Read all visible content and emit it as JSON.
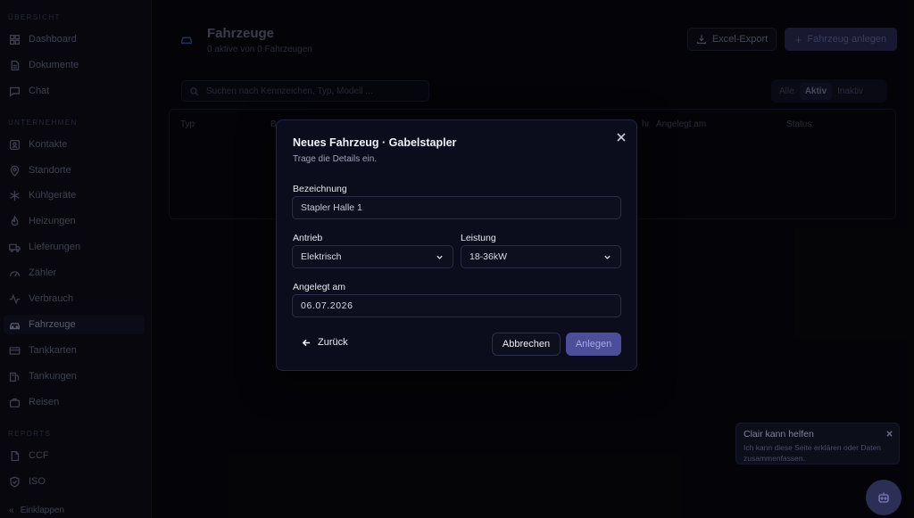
{
  "sidebar": {
    "section_overview": "ÜBERSICHT",
    "section_company": "UNTERNEHMEN",
    "section_reports": "REPORTS",
    "items_overview": [
      {
        "label": "Dashboard",
        "icon": "grid-icon"
      },
      {
        "label": "Dokumente",
        "icon": "document-icon"
      },
      {
        "label": "Chat",
        "icon": "chat-icon"
      }
    ],
    "items_company": [
      {
        "label": "Kontakte",
        "icon": "contacts-icon"
      },
      {
        "label": "Standorte",
        "icon": "location-pin-icon"
      },
      {
        "label": "Kühlgeräte",
        "icon": "snowflake-icon"
      },
      {
        "label": "Heizungen",
        "icon": "flame-icon"
      },
      {
        "label": "Lieferungen",
        "icon": "truck-icon"
      },
      {
        "label": "Zähler",
        "icon": "gauge-icon"
      },
      {
        "label": "Verbrauch",
        "icon": "activity-icon"
      },
      {
        "label": "Fahrzeuge",
        "icon": "car-icon",
        "active": true
      },
      {
        "label": "Tankkarten",
        "icon": "card-icon"
      },
      {
        "label": "Tankungen",
        "icon": "fuel-icon"
      },
      {
        "label": "Reisen",
        "icon": "trip-icon"
      }
    ],
    "items_reports": [
      {
        "label": "CCF",
        "icon": "file-icon"
      },
      {
        "label": "ISO",
        "icon": "shield-icon"
      }
    ],
    "collapse_label": "Einklappen"
  },
  "page": {
    "title": "Fahrzeuge",
    "subtitle": "0 aktive von 0 Fahrzeugen",
    "export_label": "Excel-Export",
    "add_label": "Fahrzeug anlegen",
    "search_placeholder": "Suchen nach Kennzeichen, Typ, Modell ...",
    "filters": [
      "Alle",
      "Aktiv",
      "Inaktiv"
    ],
    "active_filter": "Aktiv",
    "columns": [
      "Typ",
      "B",
      "hr",
      "Angelegt am",
      "Status"
    ]
  },
  "modal": {
    "title": "Neues Fahrzeug · Gabelstapler",
    "subtitle": "Trage die Details ein.",
    "name_label": "Bezeichnung",
    "name_value": "Stapler Halle 1",
    "drive_label": "Antrieb",
    "drive_value": "Elektrisch",
    "power_label": "Leistung",
    "power_value": "18-36kW",
    "date_label": "Angelegt am",
    "date_value": "06.07.2026",
    "back_label": "Zurück",
    "cancel_label": "Abbrechen",
    "create_label": "Anlegen"
  },
  "assistant": {
    "title": "Clair kann helfen",
    "text": "Ich kann diese Seite erklären oder Daten zusammenfassen."
  },
  "colors": {
    "accent": "#4d4e99",
    "background": "#07070d",
    "modal_bg": "#0b0d1c"
  }
}
